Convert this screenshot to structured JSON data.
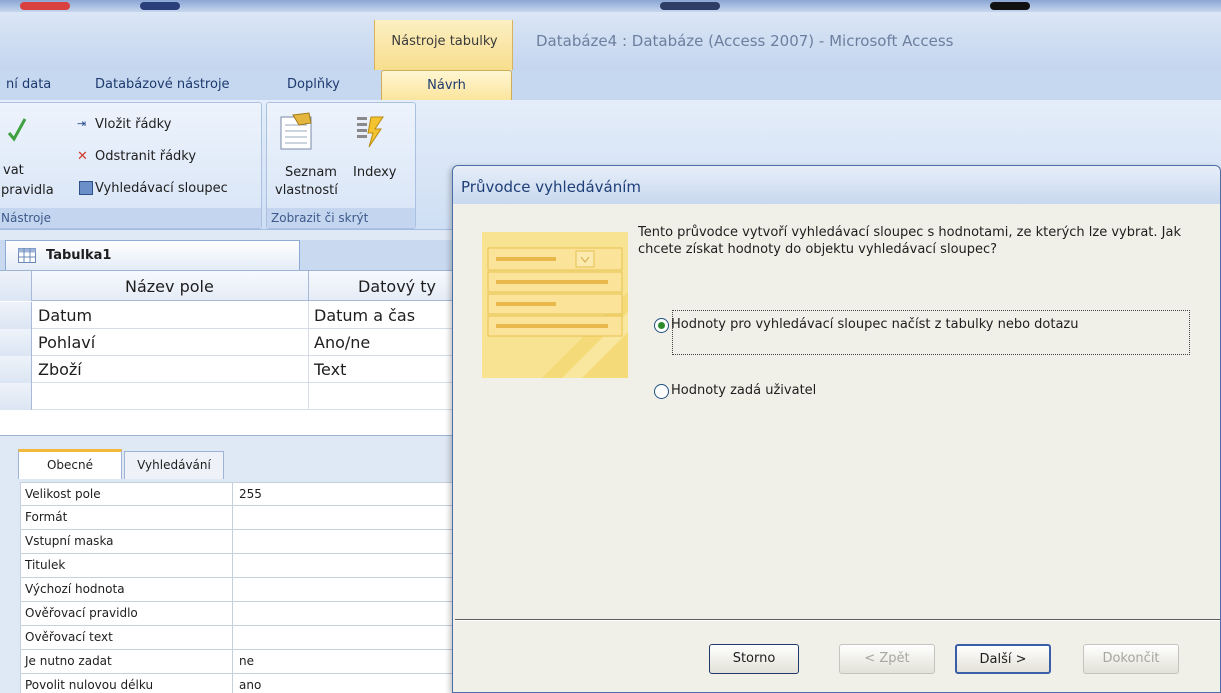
{
  "window": {
    "context_tab_group": "Nástroje tabulky",
    "title": "Databáze4 : Databáze (Access 2007) - Microsoft Access"
  },
  "tabs": [
    {
      "label": "ní data"
    },
    {
      "label": "Databázové nástroje"
    },
    {
      "label": "Doplňky"
    },
    {
      "label": "Návrh"
    }
  ],
  "ribbon": {
    "group_tools": {
      "label": "Nástroje",
      "partial_label_1": "vat",
      "partial_label_2": "pravidla",
      "insert_rows": "Vložit řádky",
      "delete_rows": "Odstranit řádky",
      "lookup_column": "Vyhledávací sloupec"
    },
    "group_show": {
      "label": "Zobrazit či skrýt",
      "property_sheet_1": "Seznam",
      "property_sheet_2": "vlastností",
      "indexes": "Indexy"
    }
  },
  "document": {
    "tab_label": "Tabulka1",
    "grid_headers": [
      "Název pole",
      "Datový ty"
    ],
    "rows": [
      {
        "name": "Datum",
        "type": "Datum a čas"
      },
      {
        "name": "Pohlaví",
        "type": "Ano/ne"
      },
      {
        "name": "Zboží",
        "type": "Text"
      }
    ]
  },
  "properties": {
    "tabs": [
      "Obecné",
      "Vyhledávání"
    ],
    "rows": [
      {
        "label": "Velikost pole",
        "value": "255"
      },
      {
        "label": "Formát",
        "value": ""
      },
      {
        "label": "Vstupní maska",
        "value": ""
      },
      {
        "label": "Titulek",
        "value": ""
      },
      {
        "label": "Výchozí hodnota",
        "value": ""
      },
      {
        "label": "Ověřovací pravidlo",
        "value": ""
      },
      {
        "label": "Ověřovací text",
        "value": ""
      },
      {
        "label": "Je nutno zadat",
        "value": "ne"
      },
      {
        "label": "Povolit nulovou délku",
        "value": "ano"
      }
    ]
  },
  "dialog": {
    "title": "Průvodce vyhledáváním",
    "description": "Tento průvodce vytvoří vyhledávací sloupec s hodnotami, ze kterých lze vybrat. Jak chcete získat hodnoty do objektu vyhledávací sloupec?",
    "option1": "Hodnoty pro vyhledávací sloupec načíst z tabulky nebo dotazu",
    "option2": "Hodnoty zadá uživatel",
    "buttons": {
      "cancel": "Storno",
      "back": "< Zpět",
      "next": "Další >",
      "finish": "Dokončit"
    }
  },
  "colors": {
    "ribbon_accent": "#fbe59c",
    "dialog_bg": "#f1f0e8",
    "radio_selected": "#2b8b2b"
  }
}
